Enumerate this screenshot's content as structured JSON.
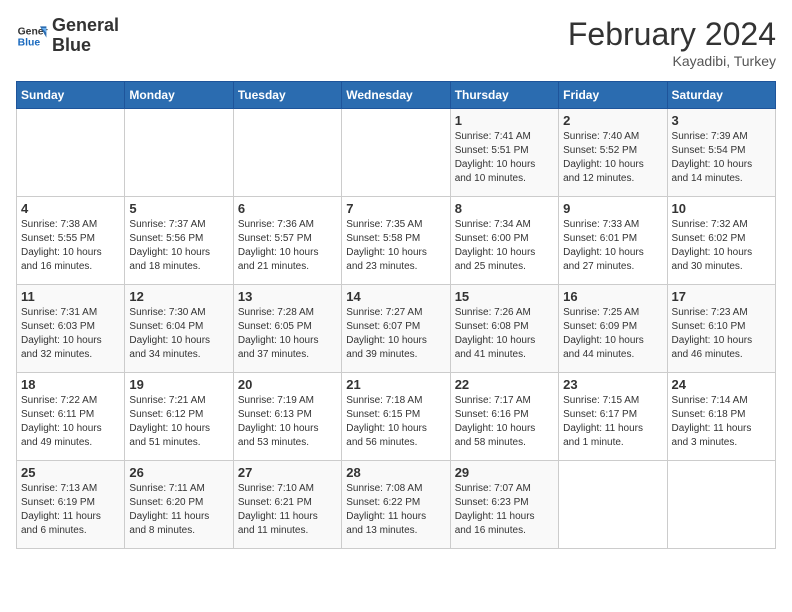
{
  "logo": {
    "line1": "General",
    "line2": "Blue"
  },
  "title": "February 2024",
  "subtitle": "Kayadibi, Turkey",
  "days_of_week": [
    "Sunday",
    "Monday",
    "Tuesday",
    "Wednesday",
    "Thursday",
    "Friday",
    "Saturday"
  ],
  "weeks": [
    [
      {
        "day": "",
        "info": ""
      },
      {
        "day": "",
        "info": ""
      },
      {
        "day": "",
        "info": ""
      },
      {
        "day": "",
        "info": ""
      },
      {
        "day": "1",
        "info": "Sunrise: 7:41 AM\nSunset: 5:51 PM\nDaylight: 10 hours\nand 10 minutes."
      },
      {
        "day": "2",
        "info": "Sunrise: 7:40 AM\nSunset: 5:52 PM\nDaylight: 10 hours\nand 12 minutes."
      },
      {
        "day": "3",
        "info": "Sunrise: 7:39 AM\nSunset: 5:54 PM\nDaylight: 10 hours\nand 14 minutes."
      }
    ],
    [
      {
        "day": "4",
        "info": "Sunrise: 7:38 AM\nSunset: 5:55 PM\nDaylight: 10 hours\nand 16 minutes."
      },
      {
        "day": "5",
        "info": "Sunrise: 7:37 AM\nSunset: 5:56 PM\nDaylight: 10 hours\nand 18 minutes."
      },
      {
        "day": "6",
        "info": "Sunrise: 7:36 AM\nSunset: 5:57 PM\nDaylight: 10 hours\nand 21 minutes."
      },
      {
        "day": "7",
        "info": "Sunrise: 7:35 AM\nSunset: 5:58 PM\nDaylight: 10 hours\nand 23 minutes."
      },
      {
        "day": "8",
        "info": "Sunrise: 7:34 AM\nSunset: 6:00 PM\nDaylight: 10 hours\nand 25 minutes."
      },
      {
        "day": "9",
        "info": "Sunrise: 7:33 AM\nSunset: 6:01 PM\nDaylight: 10 hours\nand 27 minutes."
      },
      {
        "day": "10",
        "info": "Sunrise: 7:32 AM\nSunset: 6:02 PM\nDaylight: 10 hours\nand 30 minutes."
      }
    ],
    [
      {
        "day": "11",
        "info": "Sunrise: 7:31 AM\nSunset: 6:03 PM\nDaylight: 10 hours\nand 32 minutes."
      },
      {
        "day": "12",
        "info": "Sunrise: 7:30 AM\nSunset: 6:04 PM\nDaylight: 10 hours\nand 34 minutes."
      },
      {
        "day": "13",
        "info": "Sunrise: 7:28 AM\nSunset: 6:05 PM\nDaylight: 10 hours\nand 37 minutes."
      },
      {
        "day": "14",
        "info": "Sunrise: 7:27 AM\nSunset: 6:07 PM\nDaylight: 10 hours\nand 39 minutes."
      },
      {
        "day": "15",
        "info": "Sunrise: 7:26 AM\nSunset: 6:08 PM\nDaylight: 10 hours\nand 41 minutes."
      },
      {
        "day": "16",
        "info": "Sunrise: 7:25 AM\nSunset: 6:09 PM\nDaylight: 10 hours\nand 44 minutes."
      },
      {
        "day": "17",
        "info": "Sunrise: 7:23 AM\nSunset: 6:10 PM\nDaylight: 10 hours\nand 46 minutes."
      }
    ],
    [
      {
        "day": "18",
        "info": "Sunrise: 7:22 AM\nSunset: 6:11 PM\nDaylight: 10 hours\nand 49 minutes."
      },
      {
        "day": "19",
        "info": "Sunrise: 7:21 AM\nSunset: 6:12 PM\nDaylight: 10 hours\nand 51 minutes."
      },
      {
        "day": "20",
        "info": "Sunrise: 7:19 AM\nSunset: 6:13 PM\nDaylight: 10 hours\nand 53 minutes."
      },
      {
        "day": "21",
        "info": "Sunrise: 7:18 AM\nSunset: 6:15 PM\nDaylight: 10 hours\nand 56 minutes."
      },
      {
        "day": "22",
        "info": "Sunrise: 7:17 AM\nSunset: 6:16 PM\nDaylight: 10 hours\nand 58 minutes."
      },
      {
        "day": "23",
        "info": "Sunrise: 7:15 AM\nSunset: 6:17 PM\nDaylight: 11 hours\nand 1 minute."
      },
      {
        "day": "24",
        "info": "Sunrise: 7:14 AM\nSunset: 6:18 PM\nDaylight: 11 hours\nand 3 minutes."
      }
    ],
    [
      {
        "day": "25",
        "info": "Sunrise: 7:13 AM\nSunset: 6:19 PM\nDaylight: 11 hours\nand 6 minutes."
      },
      {
        "day": "26",
        "info": "Sunrise: 7:11 AM\nSunset: 6:20 PM\nDaylight: 11 hours\nand 8 minutes."
      },
      {
        "day": "27",
        "info": "Sunrise: 7:10 AM\nSunset: 6:21 PM\nDaylight: 11 hours\nand 11 minutes."
      },
      {
        "day": "28",
        "info": "Sunrise: 7:08 AM\nSunset: 6:22 PM\nDaylight: 11 hours\nand 13 minutes."
      },
      {
        "day": "29",
        "info": "Sunrise: 7:07 AM\nSunset: 6:23 PM\nDaylight: 11 hours\nand 16 minutes."
      },
      {
        "day": "",
        "info": ""
      },
      {
        "day": "",
        "info": ""
      }
    ]
  ]
}
